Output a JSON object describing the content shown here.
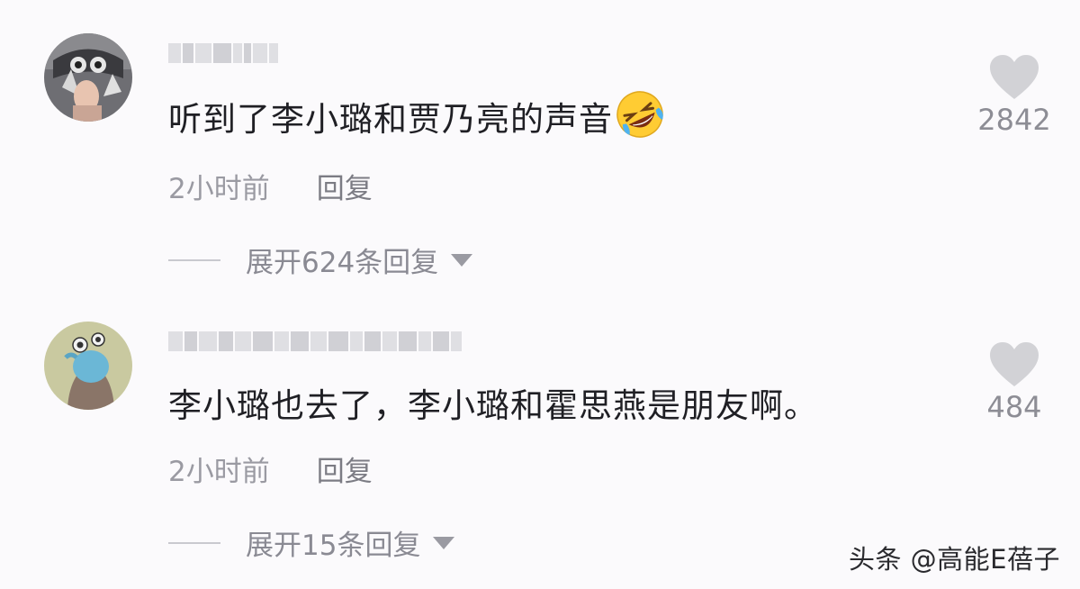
{
  "comments": [
    {
      "text": "听到了李小璐和贾乃亮的声音",
      "time": "2小时前",
      "reply": "回复",
      "expand": "展开624条回复",
      "likes": "2842",
      "emoji": "rolling-laughing-emoji"
    },
    {
      "text": "李小璐也去了，李小璐和霍思燕是朋友啊。",
      "time": "2小时前",
      "reply": "回复",
      "expand": "展开15条回复",
      "likes": "484"
    }
  ],
  "watermark": "头条 @高能E蓓子",
  "colors": {
    "background": "#fbfafc",
    "text": "#1f1f24",
    "muted": "#9a9aa2",
    "heart": "#d2d2d6"
  }
}
